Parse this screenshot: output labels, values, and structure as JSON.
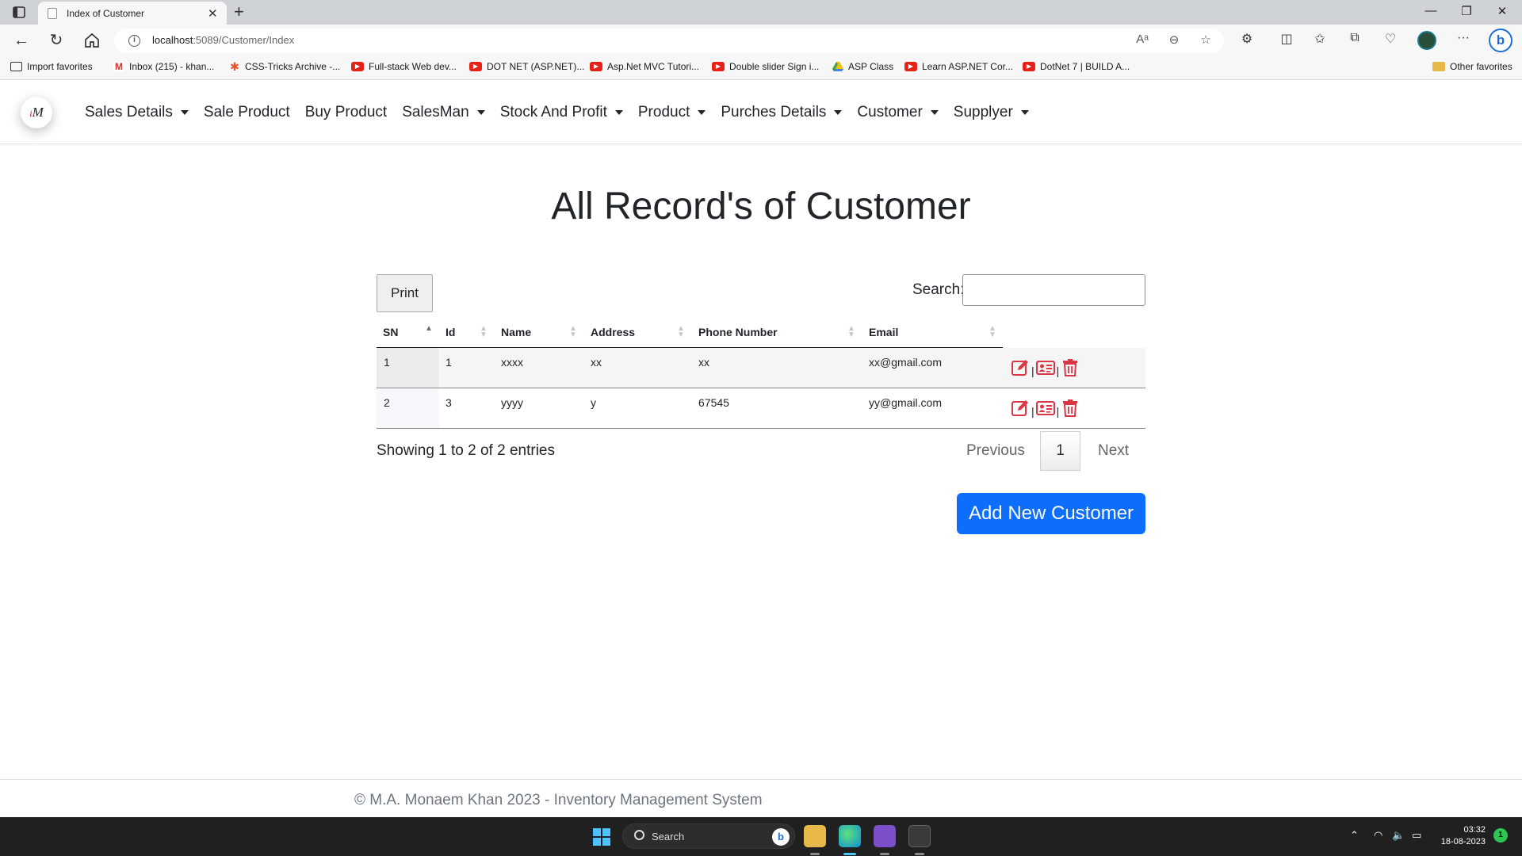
{
  "browser": {
    "tab_title": "Index of Customer",
    "url_host": "localhost",
    "url_rest": ":5089/Customer/Index",
    "bookmarks": [
      {
        "label": "Import favorites",
        "icon": "import-icon"
      },
      {
        "label": "Inbox (215) - khan...",
        "icon": "gmail-icon"
      },
      {
        "label": "CSS-Tricks Archive -...",
        "icon": "css-tricks-icon"
      },
      {
        "label": "Full-stack Web dev...",
        "icon": "youtube-icon"
      },
      {
        "label": "DOT NET (ASP.NET)...",
        "icon": "youtube-icon"
      },
      {
        "label": "Asp.Net MVC Tutori...",
        "icon": "youtube-icon"
      },
      {
        "label": "Double slider Sign i...",
        "icon": "youtube-icon"
      },
      {
        "label": "ASP Class",
        "icon": "drive-icon"
      },
      {
        "label": "Learn ASP.NET Cor...",
        "icon": "youtube-icon"
      },
      {
        "label": "DotNet 7 | BUILD A...",
        "icon": "youtube-icon"
      }
    ],
    "other_favorites": "Other favorites"
  },
  "navbar": {
    "logo_text": "M",
    "items": [
      {
        "label": "Sales Details",
        "dropdown": true
      },
      {
        "label": "Sale Product",
        "dropdown": false
      },
      {
        "label": "Buy Product",
        "dropdown": false
      },
      {
        "label": "SalesMan",
        "dropdown": true
      },
      {
        "label": "Stock And Profit",
        "dropdown": true
      },
      {
        "label": "Product",
        "dropdown": true
      },
      {
        "label": "Purches Details",
        "dropdown": true
      },
      {
        "label": "Customer",
        "dropdown": true
      },
      {
        "label": "Supplyer",
        "dropdown": true
      }
    ]
  },
  "main": {
    "title": "All Record's of Customer",
    "print_label": "Print",
    "search_label": "Search:",
    "search_value": "",
    "columns": [
      "SN",
      "Id",
      "Name",
      "Address",
      "Phone Number",
      "Email"
    ],
    "rows": [
      {
        "sn": "1",
        "id": "1",
        "name": "xxxx",
        "address": "xx",
        "phone": "xx",
        "email": "xx@gmail.com"
      },
      {
        "sn": "2",
        "id": "3",
        "name": "yyyy",
        "address": "y",
        "phone": "67545",
        "email": "yy@gmail.com"
      }
    ],
    "action_separator": "|",
    "info": "Showing 1 to 2 of 2 entries",
    "pagination": {
      "previous": "Previous",
      "current": "1",
      "next": "Next"
    },
    "add_button": "Add New Customer"
  },
  "footer": {
    "text": "© M.A. Monaem Khan 2023 - Inventory Management System"
  },
  "taskbar": {
    "search_label": "Search",
    "time": "03:32",
    "date": "18-08-2023",
    "notification_count": "1"
  },
  "colors": {
    "primary": "#0d6efd",
    "action_red": "#dc3545"
  }
}
